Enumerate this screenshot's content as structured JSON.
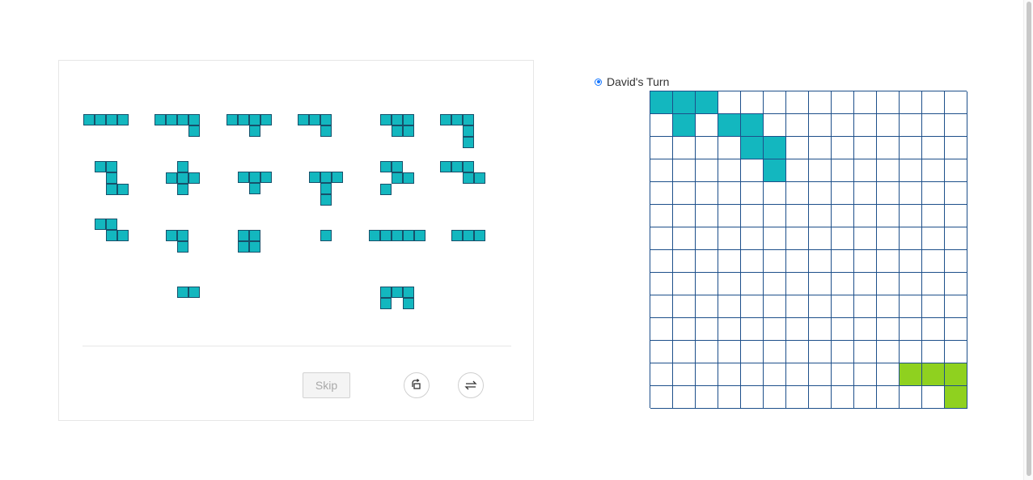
{
  "game": {
    "turn_label": "David's Turn",
    "skip_label": "Skip",
    "rotate_icon": "rotate-icon",
    "flip_icon": "flip-icon",
    "colors": {
      "player1": "#13b7bf",
      "player2": "#8fd11f",
      "grid_line": "#1d4f8a",
      "piece_border": "#17506a"
    }
  },
  "board": {
    "size": 14,
    "cells": [
      {
        "r": 0,
        "c": 0,
        "player": 1
      },
      {
        "r": 0,
        "c": 1,
        "player": 1
      },
      {
        "r": 0,
        "c": 2,
        "player": 1
      },
      {
        "r": 1,
        "c": 1,
        "player": 1
      },
      {
        "r": 1,
        "c": 3,
        "player": 1
      },
      {
        "r": 1,
        "c": 4,
        "player": 1
      },
      {
        "r": 2,
        "c": 4,
        "player": 1
      },
      {
        "r": 2,
        "c": 5,
        "player": 1
      },
      {
        "r": 3,
        "c": 5,
        "player": 1
      },
      {
        "r": 12,
        "c": 11,
        "player": 2
      },
      {
        "r": 12,
        "c": 12,
        "player": 2
      },
      {
        "r": 12,
        "c": 13,
        "player": 2
      },
      {
        "r": 13,
        "c": 13,
        "player": 2
      }
    ]
  },
  "pieces": [
    {
      "cells": [
        [
          0,
          0
        ],
        [
          0,
          1
        ],
        [
          0,
          2
        ],
        [
          0,
          3
        ]
      ]
    },
    {
      "cells": [
        [
          0,
          0
        ],
        [
          0,
          1
        ],
        [
          0,
          2
        ],
        [
          0,
          3
        ],
        [
          1,
          3
        ]
      ]
    },
    {
      "cells": [
        [
          0,
          0
        ],
        [
          0,
          1
        ],
        [
          0,
          2
        ],
        [
          0,
          3
        ],
        [
          1,
          2
        ]
      ]
    },
    {
      "cells": [
        [
          0,
          0
        ],
        [
          0,
          1
        ],
        [
          0,
          2
        ],
        [
          1,
          2
        ]
      ]
    },
    {
      "cells": [
        [
          0,
          0
        ],
        [
          0,
          1
        ],
        [
          0,
          2
        ],
        [
          1,
          1
        ],
        [
          1,
          2
        ]
      ]
    },
    {
      "cells": [
        [
          0,
          0
        ],
        [
          0,
          1
        ],
        [
          0,
          2
        ],
        [
          1,
          2
        ],
        [
          2,
          2
        ]
      ]
    },
    {
      "cells": [
        [
          0,
          0
        ],
        [
          0,
          1
        ],
        [
          1,
          1
        ],
        [
          2,
          1
        ],
        [
          2,
          2
        ]
      ]
    },
    {
      "cells": [
        [
          0,
          1
        ],
        [
          1,
          0
        ],
        [
          1,
          1
        ],
        [
          1,
          2
        ],
        [
          2,
          1
        ]
      ]
    },
    {
      "cells": [
        [
          0,
          0
        ],
        [
          0,
          1
        ],
        [
          0,
          2
        ],
        [
          1,
          1
        ]
      ]
    },
    {
      "cells": [
        [
          0,
          0
        ],
        [
          0,
          1
        ],
        [
          0,
          2
        ],
        [
          1,
          1
        ],
        [
          2,
          1
        ]
      ]
    },
    {
      "cells": [
        [
          0,
          0
        ],
        [
          0,
          1
        ],
        [
          1,
          1
        ],
        [
          1,
          2
        ],
        [
          2,
          0
        ]
      ]
    },
    {
      "cells": [
        [
          0,
          0
        ],
        [
          0,
          1
        ],
        [
          0,
          2
        ],
        [
          1,
          2
        ],
        [
          1,
          3
        ]
      ]
    },
    {
      "cells": [
        [
          0,
          0
        ],
        [
          0,
          1
        ],
        [
          1,
          1
        ],
        [
          1,
          2
        ]
      ]
    },
    {
      "cells": [
        [
          0,
          0
        ],
        [
          0,
          1
        ],
        [
          1,
          1
        ]
      ]
    },
    {
      "cells": [
        [
          0,
          0
        ],
        [
          0,
          1
        ],
        [
          1,
          0
        ],
        [
          1,
          1
        ]
      ]
    },
    {
      "cells": [
        [
          0,
          0
        ]
      ]
    },
    {
      "cells": [
        [
          0,
          0
        ],
        [
          0,
          1
        ],
        [
          0,
          2
        ],
        [
          0,
          3
        ],
        [
          0,
          4
        ]
      ]
    },
    {
      "cells": [
        [
          0,
          0
        ],
        [
          0,
          1
        ],
        [
          0,
          2
        ]
      ]
    },
    {
      "cells": [
        [
          0,
          0
        ],
        [
          0,
          1
        ]
      ]
    },
    {
      "cells": [
        [
          0,
          0
        ],
        [
          0,
          1
        ],
        [
          0,
          2
        ],
        [
          1,
          0
        ],
        [
          1,
          2
        ]
      ]
    }
  ]
}
